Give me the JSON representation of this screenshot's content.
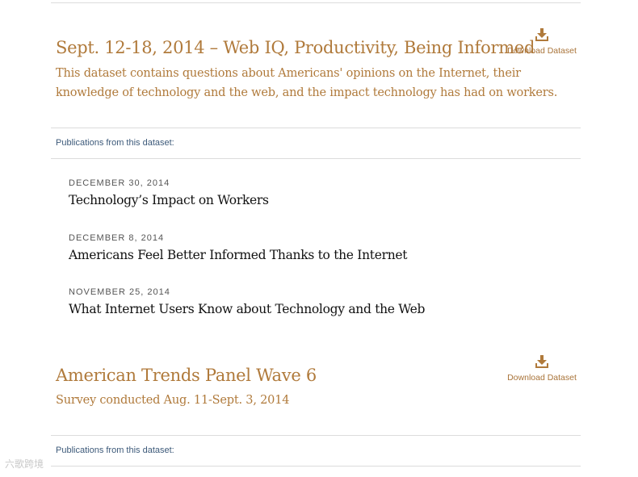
{
  "datasets": [
    {
      "title": "Sept. 12-18, 2014 – Web IQ, Productivity, Being Informed",
      "description": "This dataset contains questions about Americans' opinions on the Internet, their knowledge of technology and the web, and the impact technology has had on workers.",
      "download_label": "Download Dataset",
      "publications_label": "Publications from this dataset:",
      "publications": [
        {
          "date": "DECEMBER 30, 2014",
          "title": "Technology’s Impact on Workers"
        },
        {
          "date": "DECEMBER 8, 2014",
          "title": "Americans Feel Better Informed Thanks to the Internet"
        },
        {
          "date": "NOVEMBER 25, 2014",
          "title": "What Internet Users Know about Technology and the Web"
        }
      ]
    },
    {
      "title": "American Trends Panel Wave 6",
      "description": "Survey conducted Aug. 11-Sept. 3, 2014",
      "download_label": "Download Dataset",
      "publications_label": "Publications from this dataset:"
    }
  ],
  "watermark": "六歌跨境",
  "colors": {
    "accent": "#b07a3b",
    "link_blue": "#3d5a7a",
    "rule": "#dcdcdc"
  },
  "icons": {
    "download": "download-icon"
  }
}
